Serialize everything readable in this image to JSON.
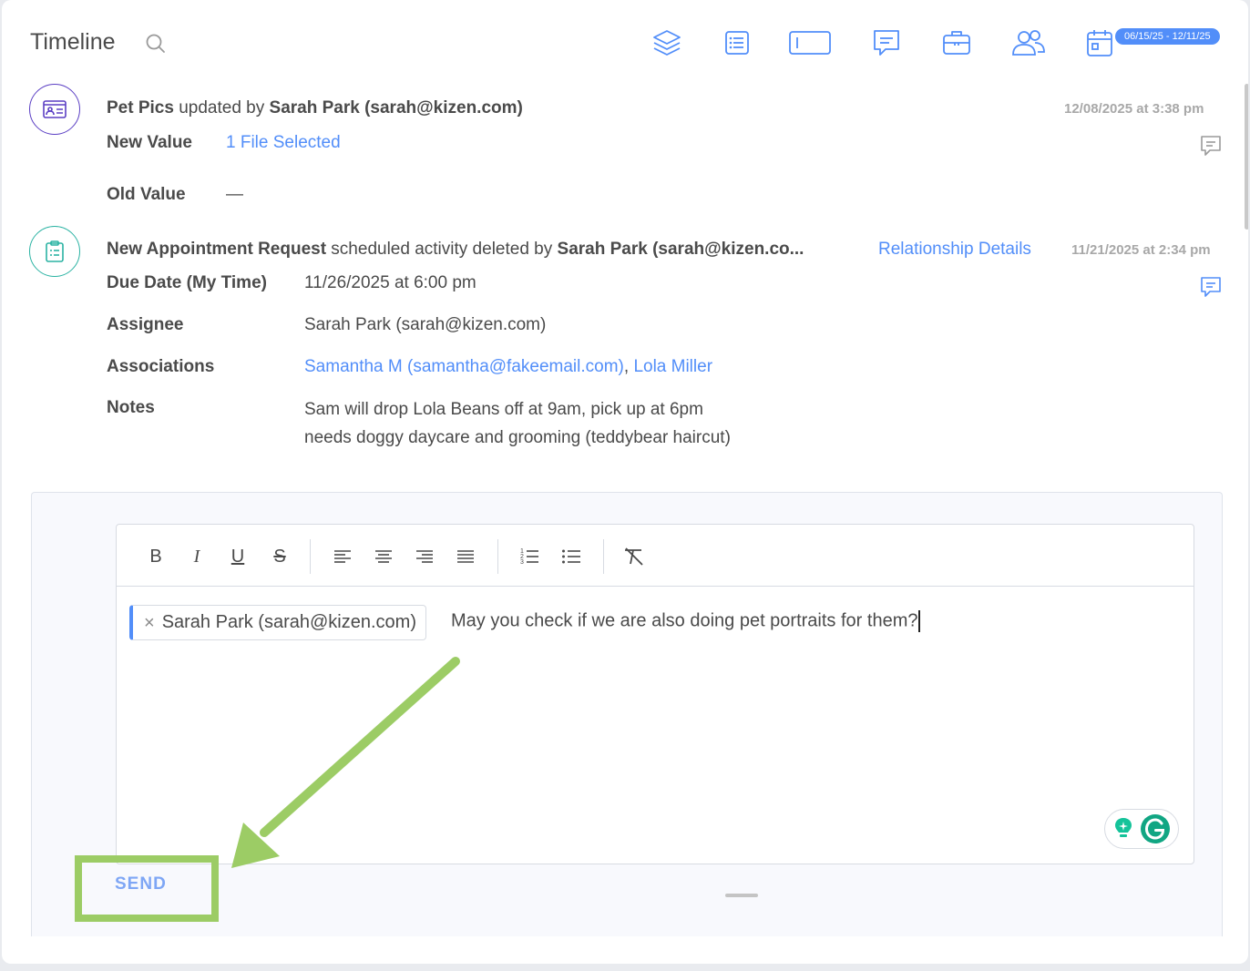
{
  "header": {
    "title": "Timeline",
    "date_range": "06/15/25 - 12/11/25",
    "filter_icons": [
      "layers-icon",
      "list-icon",
      "field-icon",
      "message-icon",
      "briefcase-icon",
      "users-icon",
      "calendar-icon"
    ]
  },
  "entries": [
    {
      "record": "Pet Pics",
      "action": " updated by ",
      "user": "Sarah Park (sarah@kizen.com)",
      "timestamp": "12/08/2025 at 3:38 pm",
      "icon": "id-card-icon",
      "fields": [
        {
          "label": "New Value",
          "value": "1 File Selected"
        },
        {
          "label": "Old Value",
          "value": "—"
        }
      ]
    },
    {
      "record": "New Appointment Request",
      "action": " scheduled activity deleted by ",
      "user": "Sarah Park (sarah@kizen.co...",
      "related_link": "Relationship Details",
      "timestamp": "11/21/2025 at 2:34 pm",
      "icon": "clipboard-icon",
      "fields": [
        {
          "label": "Due Date (My Time)",
          "value": "11/26/2025 at 6:00 pm"
        },
        {
          "label": "Assignee",
          "value": "Sarah Park (sarah@kizen.com)"
        },
        {
          "label": "Associations",
          "value": "Samantha M (samantha@fakeemail.com)",
          "value2": "Lola Miller",
          "separator": ", "
        },
        {
          "label": "Notes",
          "value": "Sam will drop Lola Beans off at 9am, pick up at 6pm",
          "value2": "needs doggy daycare and grooming (teddybear haircut)"
        }
      ]
    }
  ],
  "composer": {
    "toolbar": {
      "bold": "B",
      "italic": "I",
      "underline": "U",
      "strike": "S"
    },
    "mention": "Sarah Park (sarah@kizen.com)",
    "mention_remove": "×",
    "message": "May you check if we are also doing pet portraits for them?",
    "send_label": "SEND"
  },
  "colors": {
    "accent": "#528ef9",
    "purple": "#5b3fc4",
    "teal": "#2bb3a3",
    "highlight": "#9ccc65"
  }
}
